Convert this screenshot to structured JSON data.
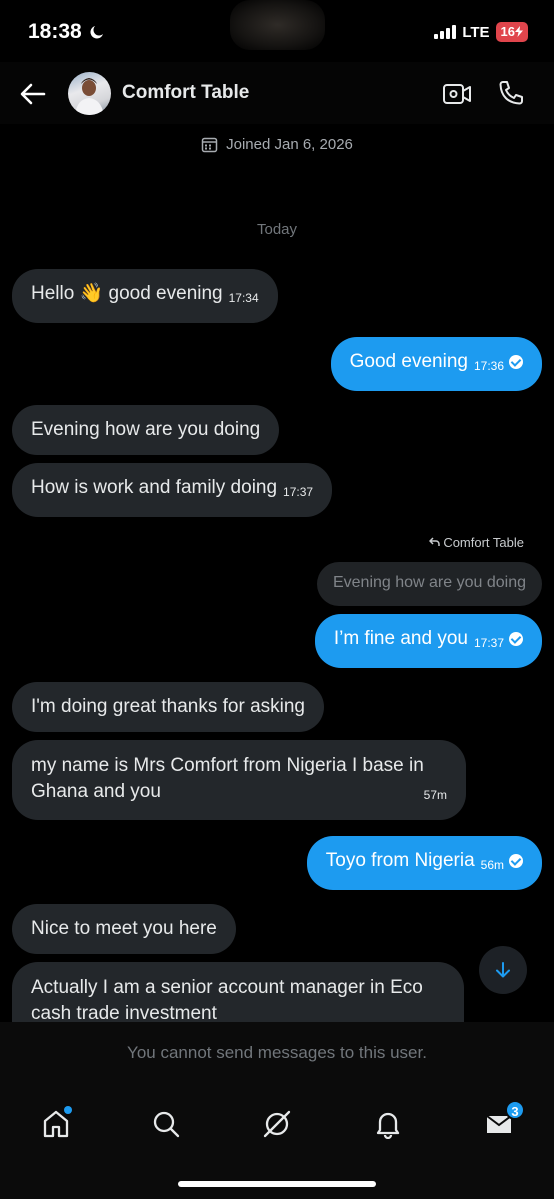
{
  "status_bar": {
    "time": "18:38",
    "network": "LTE",
    "battery": "16"
  },
  "header": {
    "contact_name": "Comfort Table"
  },
  "joined_text": "Joined Jan 6, 2026",
  "day_separator": "Today",
  "messages": [
    {
      "direction": "in",
      "text": "Hello 👋 good evening",
      "time": "17:34"
    },
    {
      "direction": "out",
      "text": "Good evening",
      "time": "17:36",
      "read": true
    },
    {
      "direction": "in",
      "text": "Evening how are you doing",
      "time": ""
    },
    {
      "direction": "in",
      "text": "How is work and family doing",
      "time": "17:37"
    },
    {
      "direction": "out",
      "text": "I’m fine and you",
      "time": "17:37",
      "read": true,
      "reply_to": {
        "author": "Comfort Table",
        "text": "Evening how are you doing"
      }
    },
    {
      "direction": "in",
      "text": "I'm doing great thanks for asking",
      "time": ""
    },
    {
      "direction": "in",
      "text_line1": "my name is Mrs Comfort from Nigeria I base in",
      "text_line2": "Ghana and you",
      "time": "57m"
    },
    {
      "direction": "out",
      "text": "Toyo from Nigeria",
      "time": "56m",
      "read": true
    },
    {
      "direction": "in",
      "text": "Nice to meet you here",
      "time": ""
    },
    {
      "direction": "in",
      "text_line1": "Actually I am a senior account manager in Eco",
      "text_line2": "cash trade investment",
      "time": ""
    }
  ],
  "composer": {
    "notice": "You cannot send messages to this user."
  },
  "bottom_nav": {
    "items": [
      {
        "icon": "home-icon",
        "has_dot": true
      },
      {
        "icon": "search-icon"
      },
      {
        "icon": "grok-icon"
      },
      {
        "icon": "bell-icon"
      },
      {
        "icon": "mail-icon",
        "badge": "3"
      }
    ]
  },
  "colors": {
    "accent": "#1d9bf0",
    "incoming_bubble": "#23272b",
    "background": "#000000"
  }
}
